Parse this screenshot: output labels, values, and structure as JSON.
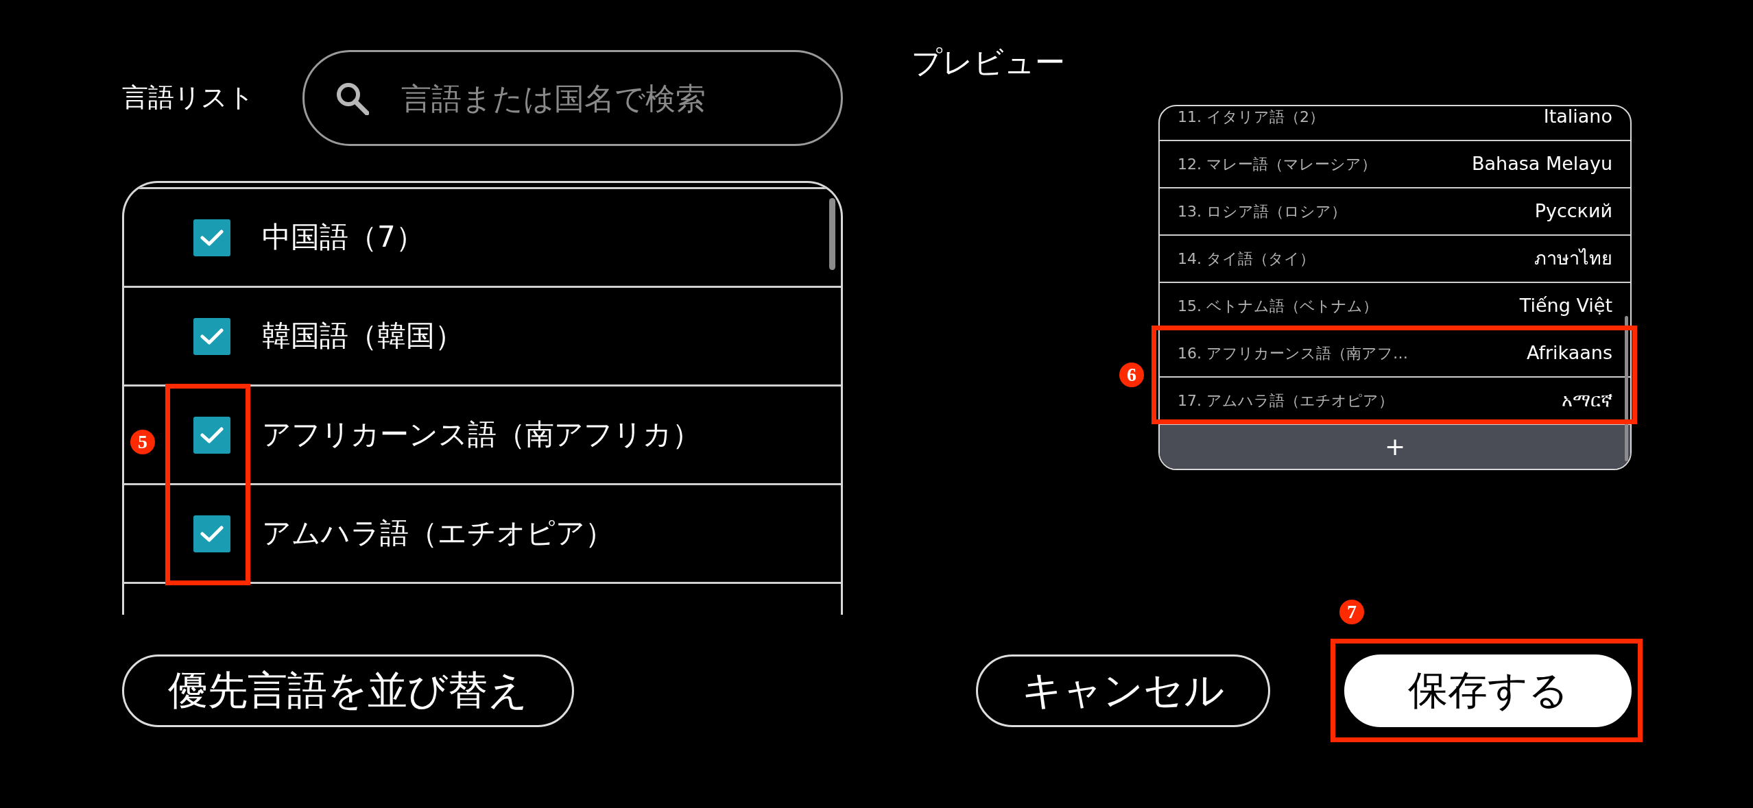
{
  "language_list": {
    "title": "言語リスト",
    "search": {
      "placeholder": "言語または国名で検索"
    },
    "items": [
      {
        "label": "中国語（7）",
        "checked": true,
        "highlighted": false
      },
      {
        "label": "韓国語（韓国）",
        "checked": true,
        "highlighted": false
      },
      {
        "label": "アフリカーンス語（南アフリカ）",
        "checked": true,
        "highlighted": true
      },
      {
        "label": "アムハラ語（エチオピア）",
        "checked": true,
        "highlighted": true
      }
    ],
    "annotation": {
      "number": "5"
    }
  },
  "preview": {
    "title": "プレビュー",
    "rows": [
      {
        "label": "11. イタリア語（2）",
        "native": "Italiano",
        "highlighted": false
      },
      {
        "label": "12. マレー語（マレーシア）",
        "native": "Bahasa Melayu",
        "highlighted": false
      },
      {
        "label": "13. ロシア語（ロシア）",
        "native": "Русский",
        "highlighted": false
      },
      {
        "label": "14. タイ語（タイ）",
        "native": "ภาษาไทย",
        "highlighted": false
      },
      {
        "label": "15. ベトナム語（ベトナム）",
        "native": "Tiếng Việt",
        "highlighted": false
      },
      {
        "label": "16. アフリカーンス語（南アフ…",
        "native": "Afrikaans",
        "highlighted": true
      },
      {
        "label": "17. アムハラ語（エチオピア）",
        "native": "አማርኛ",
        "highlighted": true
      }
    ],
    "add_button": "+",
    "annotation": {
      "number": "6"
    }
  },
  "actions": {
    "buttons": [
      {
        "kind": "outline",
        "label": "優先言語を並び替え",
        "highlighted": false
      },
      {
        "kind": "outline",
        "label": "キャンセル",
        "highlighted": false
      },
      {
        "kind": "filled",
        "label": "保存する",
        "highlighted": true
      }
    ],
    "annotation": {
      "number": "7"
    }
  }
}
